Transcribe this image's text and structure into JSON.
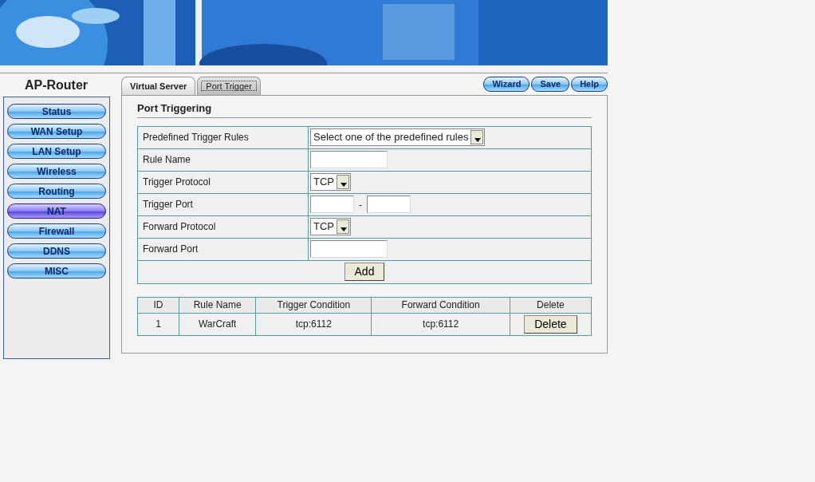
{
  "sidebar": {
    "title": "AP-Router",
    "items": [
      {
        "label": "Status",
        "selected": false
      },
      {
        "label": "WAN Setup",
        "selected": false
      },
      {
        "label": "LAN Setup",
        "selected": false
      },
      {
        "label": "Wireless",
        "selected": false
      },
      {
        "label": "Routing",
        "selected": false
      },
      {
        "label": "NAT",
        "selected": true
      },
      {
        "label": "Firewall",
        "selected": false
      },
      {
        "label": "DDNS",
        "selected": false
      },
      {
        "label": "MISC",
        "selected": false
      }
    ]
  },
  "tabs": [
    {
      "label": "Virtual Server",
      "selected": false
    },
    {
      "label": "Port Trigger",
      "selected": true
    }
  ],
  "toolbar_buttons": [
    "Wizard",
    "Save",
    "Help"
  ],
  "section_title": "Port Triggering",
  "form": {
    "rows": [
      {
        "label": "Predefined Trigger Rules",
        "kind": "select",
        "value": "Select one of the predefined rules"
      },
      {
        "label": "Rule Name",
        "kind": "text"
      },
      {
        "label": "Trigger Protocol",
        "kind": "select",
        "value": "TCP"
      },
      {
        "label": "Trigger Port",
        "kind": "range",
        "separator": "-"
      },
      {
        "label": "Forward Protocol",
        "kind": "select",
        "value": "TCP"
      },
      {
        "label": "Forward Port",
        "kind": "text"
      }
    ],
    "add_button": "Add"
  },
  "rules_table": {
    "columns": [
      "ID",
      "Rule Name",
      "Trigger Condition",
      "Forward Condition",
      "Delete"
    ],
    "rows": [
      {
        "cells": [
          "1",
          "WarCraft",
          "tcp:6112",
          "tcp:6112"
        ],
        "action": "Delete"
      }
    ]
  }
}
